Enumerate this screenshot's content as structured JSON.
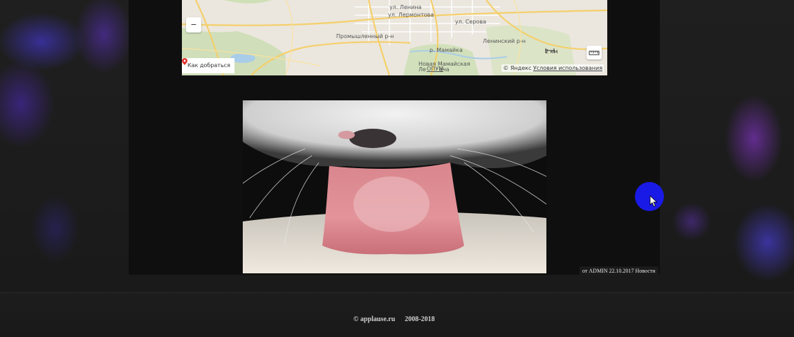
{
  "map": {
    "streets": [
      "ул. Ленина",
      "ул. Лермонтова",
      "ул. Серова"
    ],
    "districts": [
      "Промышленный р-н",
      "Ленинский р-н"
    ],
    "rivers": [
      "р. Мамайка"
    ],
    "places": [
      "Новая Мамайская",
      "Ле",
      "ОПУМ",
      "ача"
    ],
    "zoom_out_label": "−",
    "route_label": "Как добраться",
    "scale_label": "2 км",
    "copyright_brand": "© Яндекс",
    "terms_link": "Условия использования",
    "icons": [
      "location-pin-icon",
      "ruler-icon",
      "minus-icon"
    ]
  },
  "post": {
    "meta": "от ADMIN 22.10.2017 Новости"
  },
  "footer": {
    "site": "© applause.ru",
    "years": "2008-2018"
  },
  "colors": {
    "cursor_ring": "#1a1ae6",
    "map_bg": "#eae6dc",
    "route_pin": "#e0322b"
  }
}
